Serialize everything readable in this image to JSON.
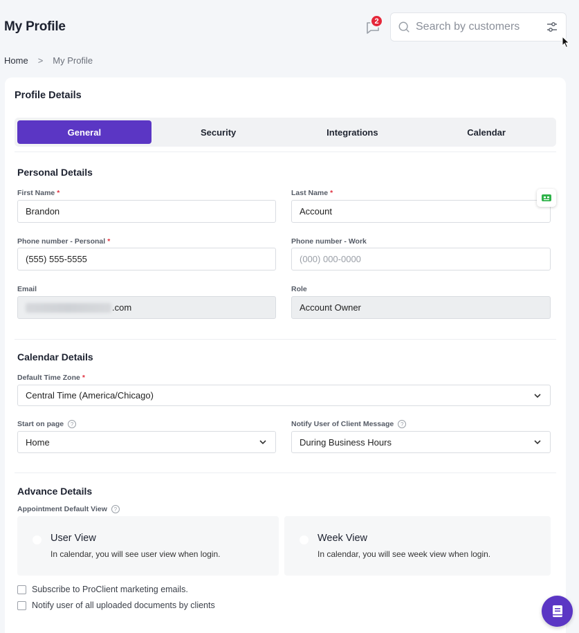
{
  "header": {
    "title": "My Profile",
    "notification_count": "2",
    "search_placeholder": "Search by customers"
  },
  "breadcrumb": {
    "home": "Home",
    "separator": ">",
    "current": "My Profile"
  },
  "card": {
    "title": "Profile Details",
    "tabs": [
      {
        "label": "General",
        "active": true
      },
      {
        "label": "Security",
        "active": false
      },
      {
        "label": "Integrations",
        "active": false
      },
      {
        "label": "Calendar",
        "active": false
      }
    ]
  },
  "personal": {
    "title": "Personal Details",
    "first_name": {
      "label": "First Name",
      "value": "Brandon"
    },
    "last_name": {
      "label": "Last Name",
      "value": "Account"
    },
    "phone_personal": {
      "label": "Phone number - Personal",
      "value": "(555) 555-5555"
    },
    "phone_work": {
      "label": "Phone number - Work",
      "placeholder": "(000) 000-0000"
    },
    "email": {
      "label": "Email",
      "value_suffix": ".com"
    },
    "role": {
      "label": "Role",
      "value": "Account Owner"
    },
    "required_mark": "*"
  },
  "calendar": {
    "title": "Calendar Details",
    "timezone": {
      "label": "Default Time Zone",
      "value": "Central Time (America/Chicago)"
    },
    "start_page": {
      "label": "Start on page",
      "value": "Home"
    },
    "notify": {
      "label": "Notify User of Client Message",
      "value": "During Business Hours"
    },
    "help_glyph": "?"
  },
  "advance": {
    "title": "Advance Details",
    "default_view_label": "Appointment Default View",
    "views": [
      {
        "title": "User View",
        "desc": "In calendar, you will see user view when login."
      },
      {
        "title": "Week View",
        "desc": "In calendar, you will see week view when login."
      }
    ],
    "checkboxes": [
      {
        "label": "Subscribe to ProClient marketing emails.",
        "checked": false
      },
      {
        "label": "Notify user of all uploaded documents by clients",
        "checked": false
      }
    ]
  },
  "colors": {
    "accent": "#5b36c4",
    "badge": "#e5273a",
    "required": "#e0313f",
    "bot_green": "#2fb34a"
  }
}
